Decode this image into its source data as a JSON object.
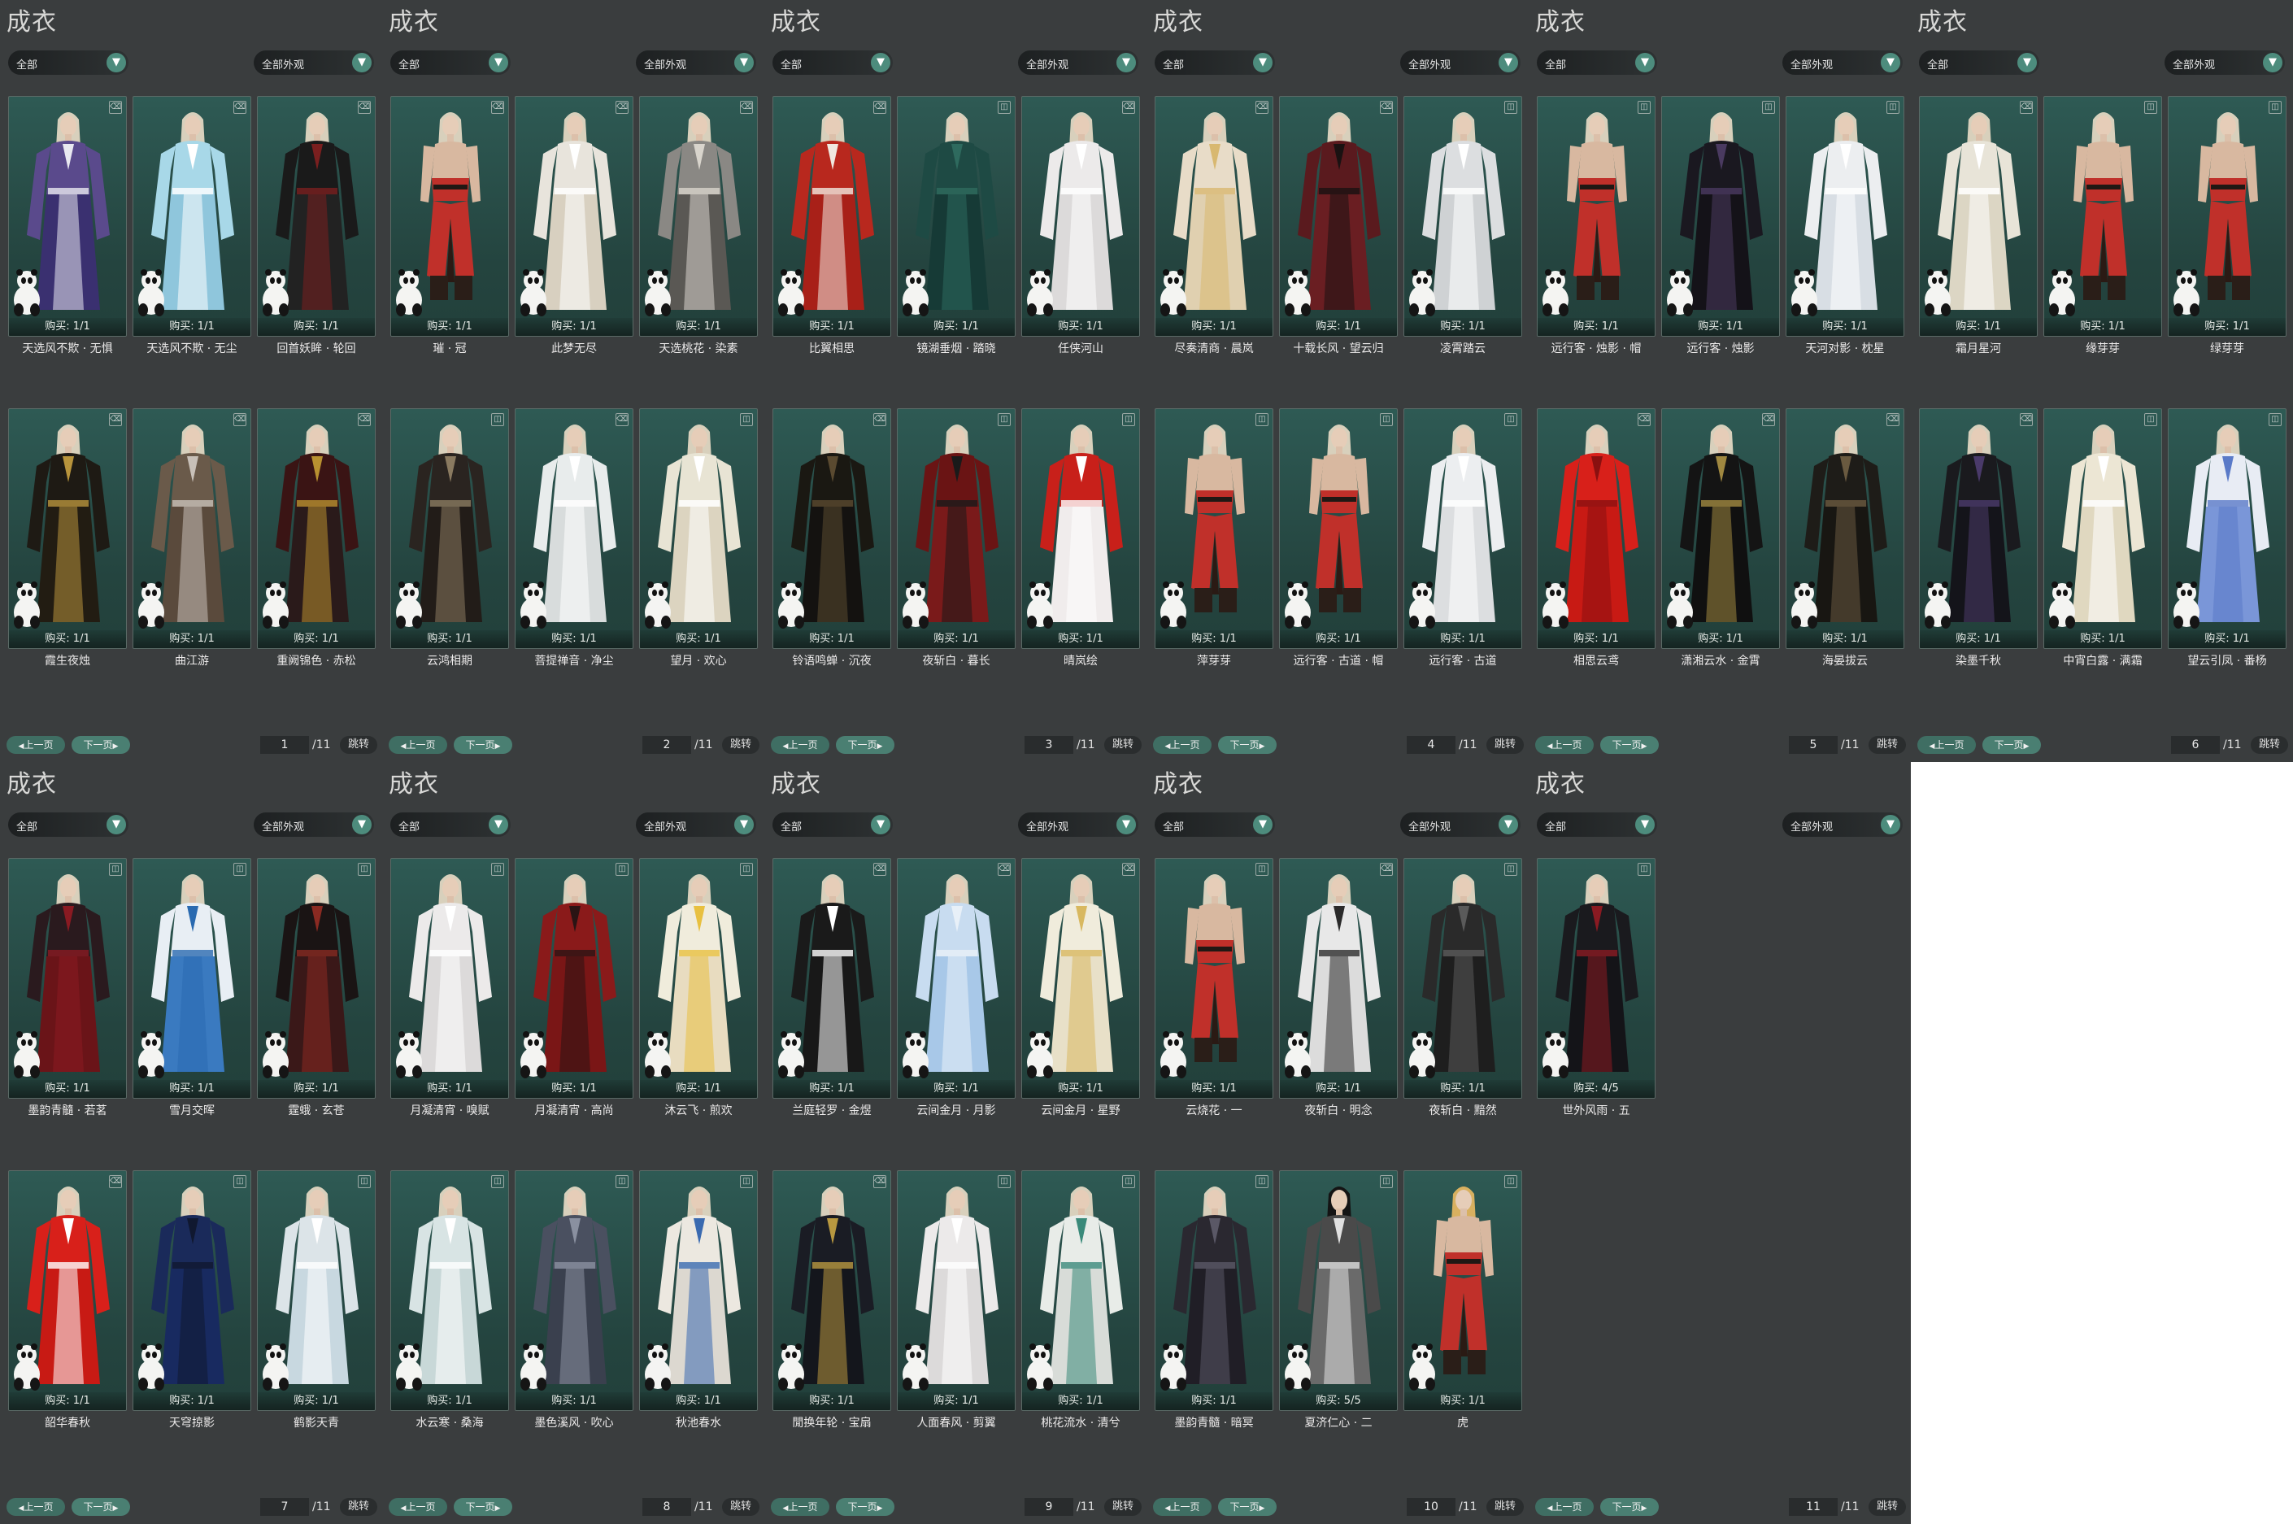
{
  "panel_title": "成衣",
  "filters": {
    "left": "全部",
    "right": "全部外观",
    "arrow": "chevron-down-icon"
  },
  "pager": {
    "prev": "上一页",
    "next": "下一页",
    "jump": "跳转",
    "total": "/11"
  },
  "colors": {
    "panel_bg": "#3a3d3e",
    "card_bg": "#2e5a54",
    "button": "#4a7f72",
    "page_bg": "#ffffff"
  },
  "pages": [
    {
      "page": "1",
      "items": [
        {
          "name": "天选风不欺 · 无惧",
          "buy": "购买: 1/1",
          "tag": "trash",
          "c1": "#5a4a8c",
          "c2": "#e8e8f0",
          "b": "#3a3070"
        },
        {
          "name": "天选风不欺 · 无尘",
          "buy": "购买: 1/1",
          "tag": "trash",
          "c1": "#a8d8e8",
          "c2": "#ffffff",
          "b": "#8fc6dc"
        },
        {
          "name": "回首妖眸 · 轮回",
          "buy": "购买: 1/1",
          "tag": "trash",
          "c1": "#1a1a1a",
          "c2": "#7a1f1f",
          "b": "#222222"
        },
        {
          "name": "霞生夜烛",
          "buy": "购买: 1/1",
          "tag": "trash",
          "c1": "#1e1a14",
          "c2": "#b8943c",
          "b": "#221c12"
        },
        {
          "name": "曲江游",
          "buy": "购买: 1/1",
          "tag": "trash",
          "c1": "#6a5a4a",
          "c2": "#c8c0b8",
          "b": "#5a4a3c"
        },
        {
          "name": "重阙锦色 · 赤松",
          "buy": "购买: 1/1",
          "tag": "trash",
          "c1": "#3a1414",
          "c2": "#b89030",
          "b": "#2a1a1a"
        }
      ]
    },
    {
      "page": "2",
      "items": [
        {
          "name": "璀 · 冠",
          "buy": "购买: 1/1",
          "tag": "trash",
          "c1": "#c0302a",
          "c2": "#2a1a14",
          "b": "#b82a22",
          "bare": true
        },
        {
          "name": "此梦无尽",
          "buy": "购买: 1/1",
          "tag": "trash",
          "c1": "#e8e4dc",
          "c2": "#ffffff",
          "b": "#d8d0c0"
        },
        {
          "name": "天选桃花 · 染素",
          "buy": "购买: 1/1",
          "tag": "trash",
          "c1": "#8a8884",
          "c2": "#d8d4cc",
          "b": "#5a5854"
        },
        {
          "name": "云鸿相期",
          "buy": "购买: 1/1",
          "tag": "dress",
          "c1": "#2a2420",
          "c2": "#8a7a60",
          "b": "#221c18"
        },
        {
          "name": "菩提禅音 · 净尘",
          "buy": "购买: 1/1",
          "tag": "trash",
          "c1": "#e8ecec",
          "c2": "#ffffff",
          "b": "#d8dcdc"
        },
        {
          "name": "望月 · 欢心",
          "buy": "购买: 1/1",
          "tag": "dress",
          "c1": "#e8e4d4",
          "c2": "#ffffff",
          "b": "#dcd4c0"
        }
      ]
    },
    {
      "page": "3",
      "items": [
        {
          "name": "比翼相思",
          "buy": "购买: 1/1",
          "tag": "trash",
          "c1": "#b8281e",
          "c2": "#f0e8e0",
          "b": "#a82018"
        },
        {
          "name": "镜湖垂烟 · 踏晓",
          "buy": "购买: 1/1",
          "tag": "dress",
          "c1": "#1e4a44",
          "c2": "#2e6a5e",
          "b": "#163a36"
        },
        {
          "name": "任侠河山",
          "buy": "购买: 1/1",
          "tag": "trash",
          "c1": "#eceaea",
          "c2": "#ffffff",
          "b": "#dcdada"
        },
        {
          "name": "铃语鸣蝉 · 沉夜",
          "buy": "购买: 1/1",
          "tag": "trash",
          "c1": "#1a1812",
          "c2": "#5a4a30",
          "b": "#141210"
        },
        {
          "name": "夜斩白 · 暮长",
          "buy": "购买: 1/1",
          "tag": "dress",
          "c1": "#6a1414",
          "c2": "#1a1a1a",
          "b": "#7a1a1a"
        },
        {
          "name": "晴岚绘",
          "buy": "购买: 1/1",
          "tag": "dress",
          "c1": "#c8201a",
          "c2": "#ffffff",
          "b": "#f0ecec"
        }
      ]
    },
    {
      "page": "4",
      "items": [
        {
          "name": "尽奏清商 · 晨岚",
          "buy": "购买: 1/1",
          "tag": "trash",
          "c1": "#e8dcc8",
          "c2": "#d8b870",
          "b": "#e0d0b0"
        },
        {
          "name": "十载长风 · 望云归",
          "buy": "购买: 1/1",
          "tag": "trash",
          "c1": "#5a1a1e",
          "c2": "#1a1212",
          "b": "#6a1e22"
        },
        {
          "name": "凌霄踏云",
          "buy": "购买: 1/1",
          "tag": "dress",
          "c1": "#dcdee0",
          "c2": "#ffffff",
          "b": "#cfd2d4"
        },
        {
          "name": "萍芽芽",
          "buy": "购买: 1/1",
          "tag": "dress",
          "c1": "#c0302a",
          "c2": "#2a1a14",
          "b": "#b82a22",
          "bare": true
        },
        {
          "name": "远行客 · 古道 · 帽",
          "buy": "购买: 1/1",
          "tag": "dress",
          "c1": "#c0302a",
          "c2": "#2a1a14",
          "b": "#b82a22",
          "bare": true
        },
        {
          "name": "远行客 · 古道",
          "buy": "购买: 1/1",
          "tag": "dress",
          "c1": "#eceef0",
          "c2": "#ffffff",
          "b": "#dcdee0"
        }
      ]
    },
    {
      "page": "5",
      "items": [
        {
          "name": "远行客 · 烛影 · 帽",
          "buy": "购买: 1/1",
          "tag": "dress",
          "c1": "#c0302a",
          "c2": "#2a1a14",
          "b": "#b82a22",
          "bare": true
        },
        {
          "name": "远行客 · 烛影",
          "buy": "购买: 1/1",
          "tag": "dress",
          "c1": "#1a1820",
          "c2": "#4a3a60",
          "b": "#141218"
        },
        {
          "name": "天河对影 · 枕星",
          "buy": "购买: 1/1",
          "tag": "dress",
          "c1": "#eceef0",
          "c2": "#ffffff",
          "b": "#d8dee4"
        },
        {
          "name": "相思云鸢",
          "buy": "购买: 1/1",
          "tag": "trash",
          "c1": "#d8201a",
          "c2": "#8a1010",
          "b": "#c81a14"
        },
        {
          "name": "潇湘云水 · 金霄",
          "buy": "购买: 1/1",
          "tag": "trash",
          "c1": "#141414",
          "c2": "#a08840",
          "b": "#101010"
        },
        {
          "name": "海晏拔云",
          "buy": "购买: 1/1",
          "tag": "trash",
          "c1": "#1e1c18",
          "c2": "#6a5a40",
          "b": "#181612"
        }
      ]
    },
    {
      "page": "6",
      "items": [
        {
          "name": "霜月星河",
          "buy": "购买: 1/1",
          "tag": "trash",
          "c1": "#e8e4d8",
          "c2": "#ffffff",
          "b": "#dcd6c4"
        },
        {
          "name": "缘芽芽",
          "buy": "购买: 1/1",
          "tag": "dress",
          "c1": "#c0302a",
          "c2": "#2a1a14",
          "b": "#b82a22",
          "bare": true
        },
        {
          "name": "绿芽芽",
          "buy": "购买: 1/1",
          "tag": "dress",
          "c1": "#c0302a",
          "c2": "#2a1a14",
          "b": "#b82a22",
          "bare": true
        },
        {
          "name": "染墨千秋",
          "buy": "购买: 1/1",
          "tag": "trash",
          "c1": "#1a1a1e",
          "c2": "#4a3a6a",
          "b": "#14141a"
        },
        {
          "name": "中宵白露 · 满霜",
          "buy": "购买: 1/1",
          "tag": "dress",
          "c1": "#ece6d4",
          "c2": "#ffffff",
          "b": "#e0d8c0"
        },
        {
          "name": "望云引凤 · 番杨",
          "buy": "购买: 1/1",
          "tag": "dress",
          "c1": "#e8ecf4",
          "c2": "#5a7ac8",
          "b": "#7a96d8"
        }
      ]
    },
    {
      "page": "7",
      "items": [
        {
          "name": "墨韵青髓 · 若茗",
          "buy": "购买: 1/1",
          "tag": "dress",
          "c1": "#2a1a1e",
          "c2": "#8a1a22",
          "b": "#6a1418"
        },
        {
          "name": "雪月交晖",
          "buy": "购买: 1/1",
          "tag": "dress",
          "c1": "#e8eef4",
          "c2": "#2a6ab0",
          "b": "#3a7ac0"
        },
        {
          "name": "霆蛾 · 玄苍",
          "buy": "购买: 1/1",
          "tag": "dress",
          "c1": "#1a1414",
          "c2": "#8a2a22",
          "b": "#3a1818"
        },
        {
          "name": "韶华春秋",
          "buy": "购买: 1/1",
          "tag": "trash",
          "c1": "#d8201a",
          "c2": "#ffffff",
          "b": "#c81a14"
        },
        {
          "name": "天穹掠影",
          "buy": "购买: 1/1",
          "tag": "dress",
          "c1": "#1a2a5a",
          "c2": "#101830",
          "b": "#182a60"
        },
        {
          "name": "鹤影天青",
          "buy": "购买: 1/1",
          "tag": "dress",
          "c1": "#dce4e8",
          "c2": "#ffffff",
          "b": "#c8d8e0"
        }
      ]
    },
    {
      "page": "8",
      "items": [
        {
          "name": "月凝清宵 · 嗅赋",
          "buy": "购买: 1/1",
          "tag": "dress",
          "c1": "#eceaea",
          "c2": "#ffffff",
          "b": "#dcdada"
        },
        {
          "name": "月凝清宵 · 高尚",
          "buy": "购买: 1/1",
          "tag": "dress",
          "c1": "#8a1a1a",
          "c2": "#2a1414",
          "b": "#7a1616"
        },
        {
          "name": "沐云飞 · 煎欢",
          "buy": "购买: 1/1",
          "tag": "dress",
          "c1": "#f0ecdc",
          "c2": "#e8c040",
          "b": "#e8dcc0"
        },
        {
          "name": "水云寒 · 桑海",
          "buy": "购买: 1/1",
          "tag": "dress",
          "c1": "#d8e4e4",
          "c2": "#ffffff",
          "b": "#c8d8d8"
        },
        {
          "name": "墨色溪风 · 吹心",
          "buy": "购买: 1/1",
          "tag": "dress",
          "c1": "#4a5060",
          "c2": "#8a90a0",
          "b": "#3a404e"
        },
        {
          "name": "秋池春水",
          "buy": "购买: 1/1",
          "tag": "dress",
          "c1": "#ece8e0",
          "c2": "#3a6ab0",
          "b": "#dcd8d0"
        }
      ]
    },
    {
      "page": "9",
      "items": [
        {
          "name": "兰庭轻罗 · 金煜",
          "buy": "购买: 1/1",
          "tag": "trash",
          "c1": "#1a1a1a",
          "c2": "#ffffff",
          "b": "#181818"
        },
        {
          "name": "云间金月 · 月影",
          "buy": "购买: 1/1",
          "tag": "trash",
          "c1": "#c8dcf0",
          "c2": "#e8f0f8",
          "b": "#a8c8e8"
        },
        {
          "name": "云间金月 · 星野",
          "buy": "购买: 1/1",
          "tag": "trash",
          "c1": "#f0ecdc",
          "c2": "#d8b860",
          "b": "#e8e0c8"
        },
        {
          "name": "閒换年轮 · 宝扇",
          "buy": "购买: 1/1",
          "tag": "trash",
          "c1": "#1a1c24",
          "c2": "#b89840",
          "b": "#14161c"
        },
        {
          "name": "人面春风 · 剪翼",
          "buy": "购买: 1/1",
          "tag": "dress",
          "c1": "#eceaea",
          "c2": "#ffffff",
          "b": "#dcdada"
        },
        {
          "name": "桃花流水 · 清兮",
          "buy": "购买: 1/1",
          "tag": "dress",
          "c1": "#e8ece8",
          "c2": "#3a8a7a",
          "b": "#d8dcd8"
        }
      ]
    },
    {
      "page": "10",
      "items": [
        {
          "name": "云烧花 · 一",
          "buy": "购买: 1/1",
          "tag": "dress",
          "c1": "#c0302a",
          "c2": "#2a1a14",
          "b": "#b82a22",
          "bare": true
        },
        {
          "name": "夜斩白 · 明念",
          "buy": "购买: 1/1",
          "tag": "trash",
          "c1": "#e8e8e8",
          "c2": "#2a2a2a",
          "b": "#dcdcdc"
        },
        {
          "name": "夜斩白 · 黯然",
          "buy": "购买: 1/1",
          "tag": "dress",
          "c1": "#2a2a2a",
          "c2": "#5a5a5a",
          "b": "#1e1e1e"
        },
        {
          "name": "墨韵青髓 · 暗冥",
          "buy": "购买: 1/1",
          "tag": "dress",
          "c1": "#2a2830",
          "c2": "#5a5866",
          "b": "#201e26"
        },
        {
          "name": "夏济仁心 · 二",
          "buy": "购买: 5/5",
          "tag": "dress",
          "c1": "#4a4a4a",
          "c2": "#e0e0e0",
          "b": "#6a6a6a",
          "dark": true
        },
        {
          "name": "虎",
          "buy": "购买: 1/1",
          "tag": "dress",
          "c1": "#c0302a",
          "c2": "#2a1a14",
          "b": "#b82a22",
          "bare": true,
          "blond": true
        }
      ]
    },
    {
      "page": "11",
      "items": [
        {
          "name": "世外风雨 · 五",
          "buy": "购买: 4/5",
          "tag": "dress",
          "c1": "#1a1a1e",
          "c2": "#8a1a22",
          "b": "#141418"
        }
      ]
    }
  ]
}
